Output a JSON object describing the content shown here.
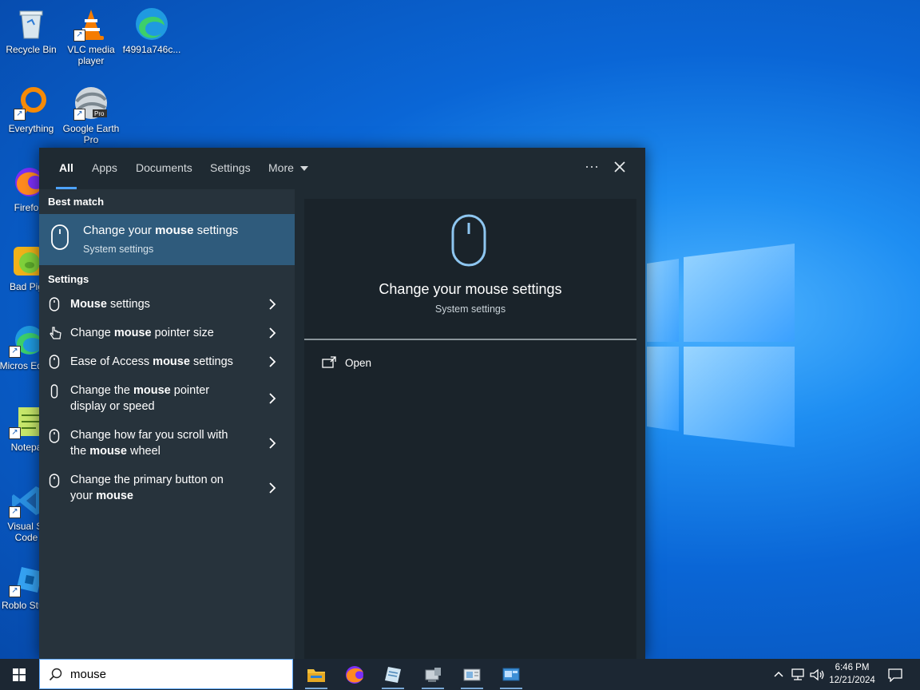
{
  "desktop": {
    "icons": [
      {
        "label": "Recycle Bin"
      },
      {
        "label": "VLC media player"
      },
      {
        "label": "f4991a746c..."
      },
      {
        "label": "Everything"
      },
      {
        "label": "Google Earth Pro"
      },
      {
        "label": "Firefo"
      },
      {
        "label": "Bad Pig"
      },
      {
        "label": "Micros Edge"
      },
      {
        "label": "Notepa"
      },
      {
        "label": "Visual St Code"
      },
      {
        "label": "Roblo Studi"
      }
    ]
  },
  "search_panel": {
    "tabs": [
      {
        "label": "All",
        "active": true
      },
      {
        "label": "Apps"
      },
      {
        "label": "Documents"
      },
      {
        "label": "Settings"
      },
      {
        "label": "More"
      }
    ],
    "more_options": "···",
    "best_match": {
      "section_title": "Best match",
      "title_pre": "Change your ",
      "title_bold": "mouse",
      "title_post": " settings",
      "subtitle": "System settings"
    },
    "settings": {
      "section_title": "Settings",
      "items": [
        {
          "pre": "",
          "bold": "Mouse",
          "post": " settings"
        },
        {
          "pre": "Change ",
          "bold": "mouse",
          "post": " pointer size"
        },
        {
          "pre": "Ease of Access ",
          "bold": "mouse",
          "post": " settings"
        },
        {
          "pre": "Change the ",
          "bold": "mouse",
          "post": " pointer display or speed"
        },
        {
          "pre": "Change how far you scroll with the ",
          "bold": "mouse",
          "post": " wheel"
        },
        {
          "pre": "Change the primary button on your ",
          "bold": "mouse",
          "post": ""
        }
      ]
    },
    "preview": {
      "title": "Change your mouse settings",
      "subtitle": "System settings",
      "actions": [
        {
          "label": "Open"
        }
      ]
    }
  },
  "taskbar": {
    "search_value": "mouse",
    "clock_time": "6:46 PM",
    "clock_date": "12/21/2024"
  },
  "colors": {
    "accent": "#4da3ff",
    "selection": "#2f5b7c",
    "panel": "#1f2a32"
  }
}
